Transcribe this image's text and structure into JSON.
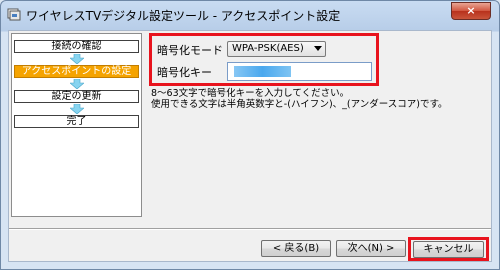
{
  "window": {
    "title": "ワイヤレスTVデジタル設定ツール - アクセスポイント設定",
    "close_label": "×"
  },
  "steps": [
    {
      "label": "接続の確認",
      "active": false
    },
    {
      "label": "アクセスポイントの設定",
      "active": true
    },
    {
      "label": "設定の更新",
      "active": false
    },
    {
      "label": "完了",
      "active": false
    }
  ],
  "form": {
    "encryption_mode_label": "暗号化モード",
    "encryption_mode_value": "WPA-PSK(AES)",
    "encryption_key_label": "暗号化キー"
  },
  "help": {
    "line1": "8～63文字で暗号化キーを入力してください。",
    "line2": "使用できる文字は半角英数字と-(ハイフン)、_(アンダースコア)です。"
  },
  "buttons": {
    "back": "< 戻る(B)",
    "next": "次へ(N) >",
    "cancel": "キャンセル"
  },
  "colors": {
    "active_step": "#f5a300",
    "highlight": "#e8131d",
    "arrow": "#87d4f0"
  }
}
